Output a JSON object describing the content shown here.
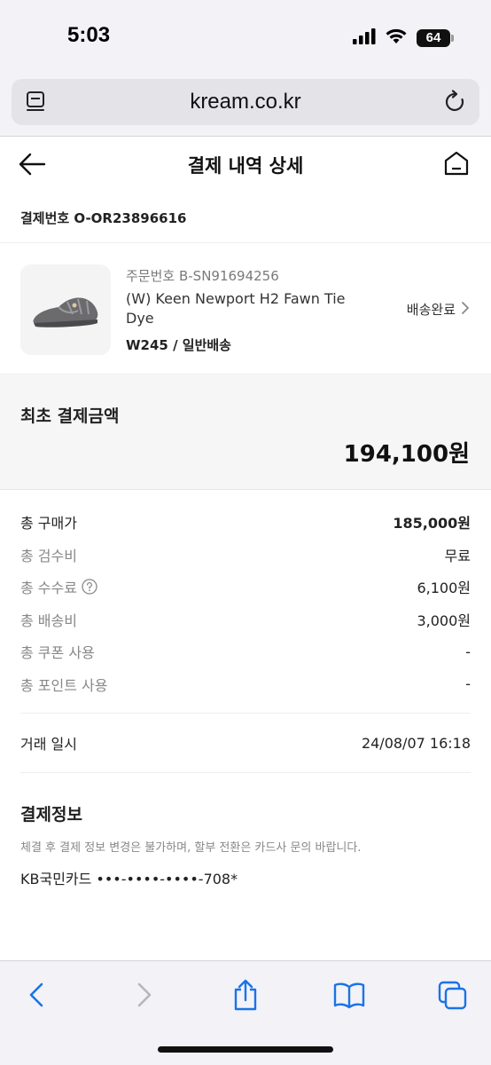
{
  "status_bar": {
    "time": "5:03",
    "battery": "64"
  },
  "browser": {
    "url": "kream.co.kr"
  },
  "header": {
    "title": "결제 내역 상세"
  },
  "payment_number": "결제번호 O-OR23896616",
  "product": {
    "order_number": "주문번호 B-SN91694256",
    "name": "(W) Keen Newport H2 Fawn Tie Dye",
    "option": "W245 / 일반배송",
    "status": "배송완료"
  },
  "first_payment": {
    "label": "최초 결제금액",
    "amount": "194,100원"
  },
  "breakdown": [
    {
      "label": "총 구매가",
      "value": "185,000원"
    },
    {
      "label": "총 검수비",
      "value": "무료"
    },
    {
      "label": "총 수수료",
      "value": "6,100원"
    },
    {
      "label": "총 배송비",
      "value": "3,000원"
    },
    {
      "label": "총 쿠폰 사용",
      "value": "-"
    },
    {
      "label": "총 포인트 사용",
      "value": "-"
    }
  ],
  "transaction": {
    "label": "거래 일시",
    "value": "24/08/07 16:18"
  },
  "payment_info": {
    "title": "결제정보",
    "note": "체결 후 결제 정보 변경은 불가하며, 할부 전환은 카드사 문의 바랍니다.",
    "card": "KB국민카드 •••-••••-••••-708*"
  },
  "colors": {
    "accent_ios_blue": "#1a73e8",
    "muted_text": "#888888",
    "section_bg": "#f6f6f6"
  }
}
